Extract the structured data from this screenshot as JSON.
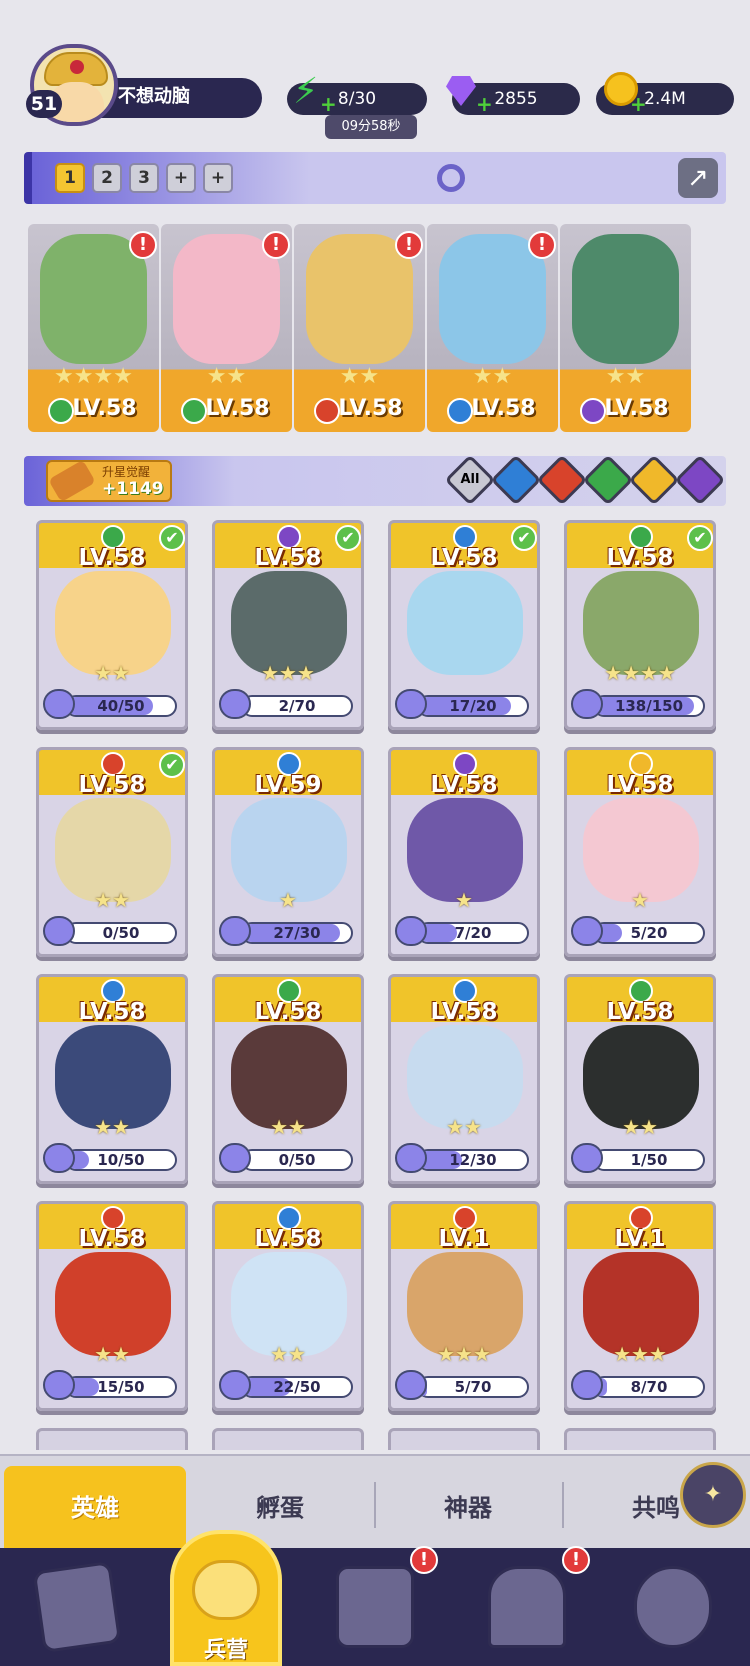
{
  "player": {
    "level": "51",
    "name": "不想动脑"
  },
  "resources": {
    "energy": "8/30",
    "energy_timer": "09分58秒",
    "gems": "2855",
    "gold": "2.4M",
    "plus": "+"
  },
  "team_tabs": [
    "1",
    "2",
    "3",
    "+",
    "+"
  ],
  "team_heroes": [
    {
      "level": "LV.58",
      "stars": "★★★★",
      "element": "wood",
      "element_color": "#3ba94a",
      "alert": "!",
      "art_color": "#7fb26a"
    },
    {
      "level": "LV.58",
      "stars": "★★",
      "element": "wood",
      "element_color": "#3ba94a",
      "alert": "!",
      "art_color": "#f3b8c8"
    },
    {
      "level": "LV.58",
      "stars": "★★",
      "element": "fire",
      "element_color": "#d8432b",
      "alert": "!",
      "art_color": "#e9c36a"
    },
    {
      "level": "LV.58",
      "stars": "★★",
      "element": "water",
      "element_color": "#2f7fd6",
      "alert": "!",
      "art_color": "#8cc6e8"
    },
    {
      "level": "LV.58",
      "stars": "★★",
      "element": "dark",
      "element_color": "#7d47c4",
      "art_color": "#4e8a6a"
    }
  ],
  "upgrade": {
    "title": "升星觉醒",
    "value": "+1149"
  },
  "filters": [
    {
      "name": "all",
      "label": "All",
      "color": "#c8c8d2"
    },
    {
      "name": "water",
      "color": "#2f7fd6"
    },
    {
      "name": "fire",
      "color": "#d8432b"
    },
    {
      "name": "wood",
      "color": "#3ba94a"
    },
    {
      "name": "light",
      "color": "#f0b82a"
    },
    {
      "name": "dark",
      "color": "#7d47c4"
    }
  ],
  "heroes": [
    {
      "level": "LV.58",
      "element_color": "#3ba94a",
      "stars": "★★",
      "count": "40/50",
      "progress": 0.8,
      "check": "✔",
      "art_color": "#f7d38a"
    },
    {
      "level": "LV.58",
      "element_color": "#7d47c4",
      "stars": "★★★",
      "count": "2/70",
      "progress": 0.03,
      "check": "✔",
      "art_color": "#5b6b6a"
    },
    {
      "level": "LV.58",
      "element_color": "#2f7fd6",
      "stars": "",
      "count": "17/20",
      "progress": 0.85,
      "check": "✔",
      "art_color": "#a9d7ef"
    },
    {
      "level": "LV.58",
      "element_color": "#3ba94a",
      "stars": "★★★★",
      "count": "138/150",
      "progress": 0.92,
      "check": "✔",
      "art_color": "#8aa86a"
    },
    {
      "level": "LV.58",
      "element_color": "#d8432b",
      "stars": "★★",
      "count": "0/50",
      "progress": 0,
      "check": "✔",
      "art_color": "#e5d7a8"
    },
    {
      "level": "LV.59",
      "element_color": "#2f7fd6",
      "stars": "★",
      "count": "27/30",
      "progress": 0.9,
      "art_color": "#b9d4ef"
    },
    {
      "level": "LV.58",
      "element_color": "#7d47c4",
      "stars": "★",
      "count": "7/20",
      "progress": 0.35,
      "art_color": "#6f58a8"
    },
    {
      "level": "LV.58",
      "element_color": "#f0b82a",
      "stars": "★",
      "count": "5/20",
      "progress": 0.25,
      "art_color": "#f4c8d2"
    },
    {
      "level": "LV.58",
      "element_color": "#2f7fd6",
      "stars": "★★",
      "count": "10/50",
      "progress": 0.2,
      "art_color": "#3b4a7a"
    },
    {
      "level": "LV.58",
      "element_color": "#3ba94a",
      "stars": "★★",
      "count": "0/50",
      "progress": 0,
      "art_color": "#5a3a3a"
    },
    {
      "level": "LV.58",
      "element_color": "#2f7fd6",
      "stars": "★★",
      "count": "12/30",
      "progress": 0.4,
      "art_color": "#c7dbef"
    },
    {
      "level": "LV.58",
      "element_color": "#3ba94a",
      "stars": "★★",
      "count": "1/50",
      "progress": 0.02,
      "art_color": "#2c2f2e"
    },
    {
      "level": "LV.58",
      "element_color": "#d8432b",
      "stars": "★★",
      "count": "15/50",
      "progress": 0.3,
      "art_color": "#d0402a"
    },
    {
      "level": "LV.58",
      "element_color": "#2f7fd6",
      "stars": "★★",
      "count": "22/50",
      "progress": 0.44,
      "art_color": "#cfe3f5"
    },
    {
      "level": "LV.1",
      "element_color": "#d8432b",
      "stars": "★★★",
      "count": "5/70",
      "progress": 0.07,
      "art_color": "#d9a56a"
    },
    {
      "level": "LV.1",
      "element_color": "#d8432b",
      "stars": "★★★",
      "count": "8/70",
      "progress": 0.11,
      "art_color": "#b43328"
    }
  ],
  "tabs": {
    "heroes": "英雄",
    "hatch": "孵蛋",
    "artifact": "神器",
    "resonance": "共鸣"
  },
  "nav": {
    "barracks": "兵营",
    "alert": "!"
  }
}
